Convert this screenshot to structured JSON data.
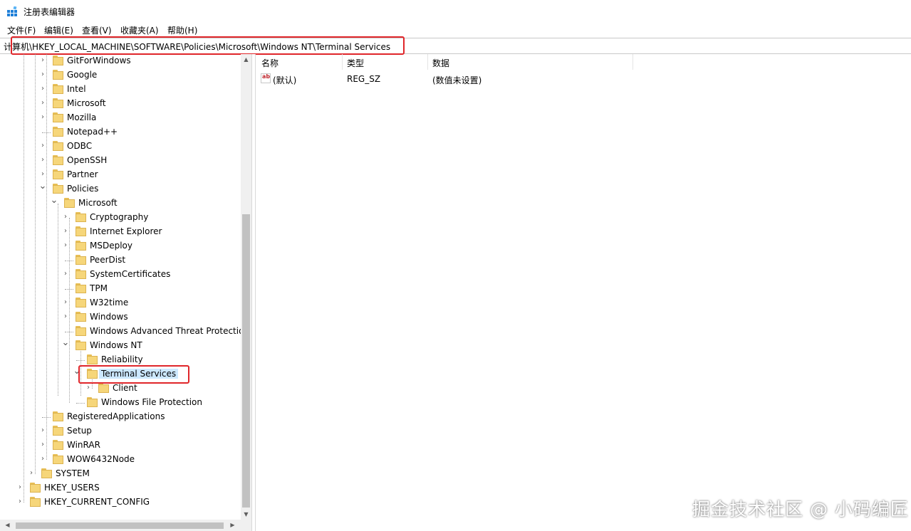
{
  "window": {
    "title": "注册表编辑器",
    "icon": "registry-editor-icon"
  },
  "menu": [
    "文件(F)",
    "编辑(E)",
    "查看(V)",
    "收藏夹(A)",
    "帮助(H)"
  ],
  "address": {
    "path": "计算机\\HKEY_LOCAL_MACHINE\\SOFTWARE\\Policies\\Microsoft\\Windows NT\\Terminal Services"
  },
  "tree": [
    {
      "label": "GitForWindows",
      "expander": "collapsed"
    },
    {
      "label": "Google",
      "expander": "collapsed"
    },
    {
      "label": "Intel",
      "expander": "collapsed"
    },
    {
      "label": "Microsoft",
      "expander": "collapsed"
    },
    {
      "label": "Mozilla",
      "expander": "collapsed"
    },
    {
      "label": "Notepad++",
      "expander": "none"
    },
    {
      "label": "ODBC",
      "expander": "collapsed"
    },
    {
      "label": "OpenSSH",
      "expander": "collapsed"
    },
    {
      "label": "Partner",
      "expander": "collapsed"
    },
    {
      "label": "Policies",
      "expander": "expanded"
    },
    {
      "label": "Microsoft",
      "expander": "expanded"
    },
    {
      "label": "Cryptography",
      "expander": "collapsed"
    },
    {
      "label": "Internet Explorer",
      "expander": "collapsed"
    },
    {
      "label": "MSDeploy",
      "expander": "collapsed"
    },
    {
      "label": "PeerDist",
      "expander": "none"
    },
    {
      "label": "SystemCertificates",
      "expander": "collapsed"
    },
    {
      "label": "TPM",
      "expander": "none"
    },
    {
      "label": "W32time",
      "expander": "collapsed"
    },
    {
      "label": "Windows",
      "expander": "collapsed"
    },
    {
      "label": "Windows Advanced Threat Protectio",
      "expander": "none"
    },
    {
      "label": "Windows NT",
      "expander": "expanded"
    },
    {
      "label": "Reliability",
      "expander": "none"
    },
    {
      "label": "Terminal Services",
      "expander": "expanded",
      "selected": true
    },
    {
      "label": "Client",
      "expander": "collapsed"
    },
    {
      "label": "Windows File Protection",
      "expander": "none"
    },
    {
      "label": "RegisteredApplications",
      "expander": "none"
    },
    {
      "label": "Setup",
      "expander": "collapsed"
    },
    {
      "label": "WinRAR",
      "expander": "collapsed"
    },
    {
      "label": "WOW6432Node",
      "expander": "collapsed"
    },
    {
      "label": "SYSTEM",
      "expander": "collapsed"
    },
    {
      "label": "HKEY_USERS",
      "expander": "collapsed"
    },
    {
      "label": "HKEY_CURRENT_CONFIG",
      "expander": "collapsed"
    }
  ],
  "list": {
    "columns": [
      "名称",
      "类型",
      "数据"
    ],
    "rows": [
      {
        "name": "(默认)",
        "type": "REG_SZ",
        "data": "(数值未设置)",
        "icon": "string-value-icon"
      }
    ]
  },
  "watermark": "掘金技术社区 @ 小码编匠",
  "colors": {
    "highlight": "#e0262a",
    "selection": "#cce8ff",
    "folder": "#f6d67a"
  }
}
